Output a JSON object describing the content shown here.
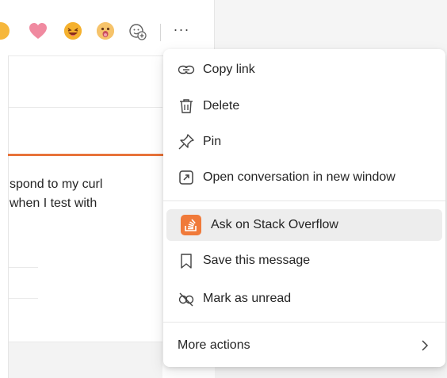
{
  "message": {
    "lines": [
      "spond to my curl",
      "when I test with"
    ]
  },
  "reactions": {
    "items": [
      "like-emoji",
      "heart-emoji",
      "laugh-emoji",
      "surprised-emoji",
      "add-reaction-icon"
    ],
    "more_label": "···"
  },
  "menu": {
    "items": [
      {
        "label": "Copy link",
        "icon": "link-icon"
      },
      {
        "label": "Delete",
        "icon": "trash-icon"
      },
      {
        "label": "Pin",
        "icon": "pin-icon"
      },
      {
        "label": "Open conversation in new window",
        "icon": "open-window-icon"
      },
      {
        "label": "Ask on Stack Overflow",
        "icon": "stack-overflow-icon",
        "highlighted": true
      },
      {
        "label": "Save this message",
        "icon": "bookmark-icon"
      },
      {
        "label": "Mark as unread",
        "icon": "mark-unread-icon"
      },
      {
        "label": "More actions",
        "icon": "chevron-right-icon"
      }
    ]
  },
  "colors": {
    "accent": "#e8733a",
    "stack_overflow": "#f07a3a",
    "highlight": "#ededed"
  }
}
